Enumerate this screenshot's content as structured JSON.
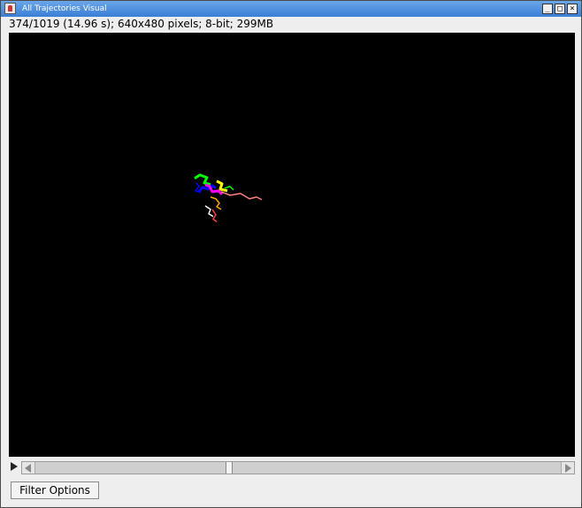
{
  "window": {
    "title": "All Trajectories Visual",
    "controls": {
      "minimize": "_",
      "maximize": "□",
      "close": "×"
    }
  },
  "status_text": "374/1019 (14.96 s); 640x480 pixels; 8-bit; 299MB",
  "slider": {
    "current_frame": 374,
    "total_frames": 1019
  },
  "buttons": {
    "filter_options": "Filter Options"
  },
  "trajectory_colors": [
    "#00ff00",
    "#0000ff",
    "#ff00ff",
    "#ffff00",
    "#ffa500",
    "#ff8080",
    "#ffffff",
    "#ff4040"
  ]
}
